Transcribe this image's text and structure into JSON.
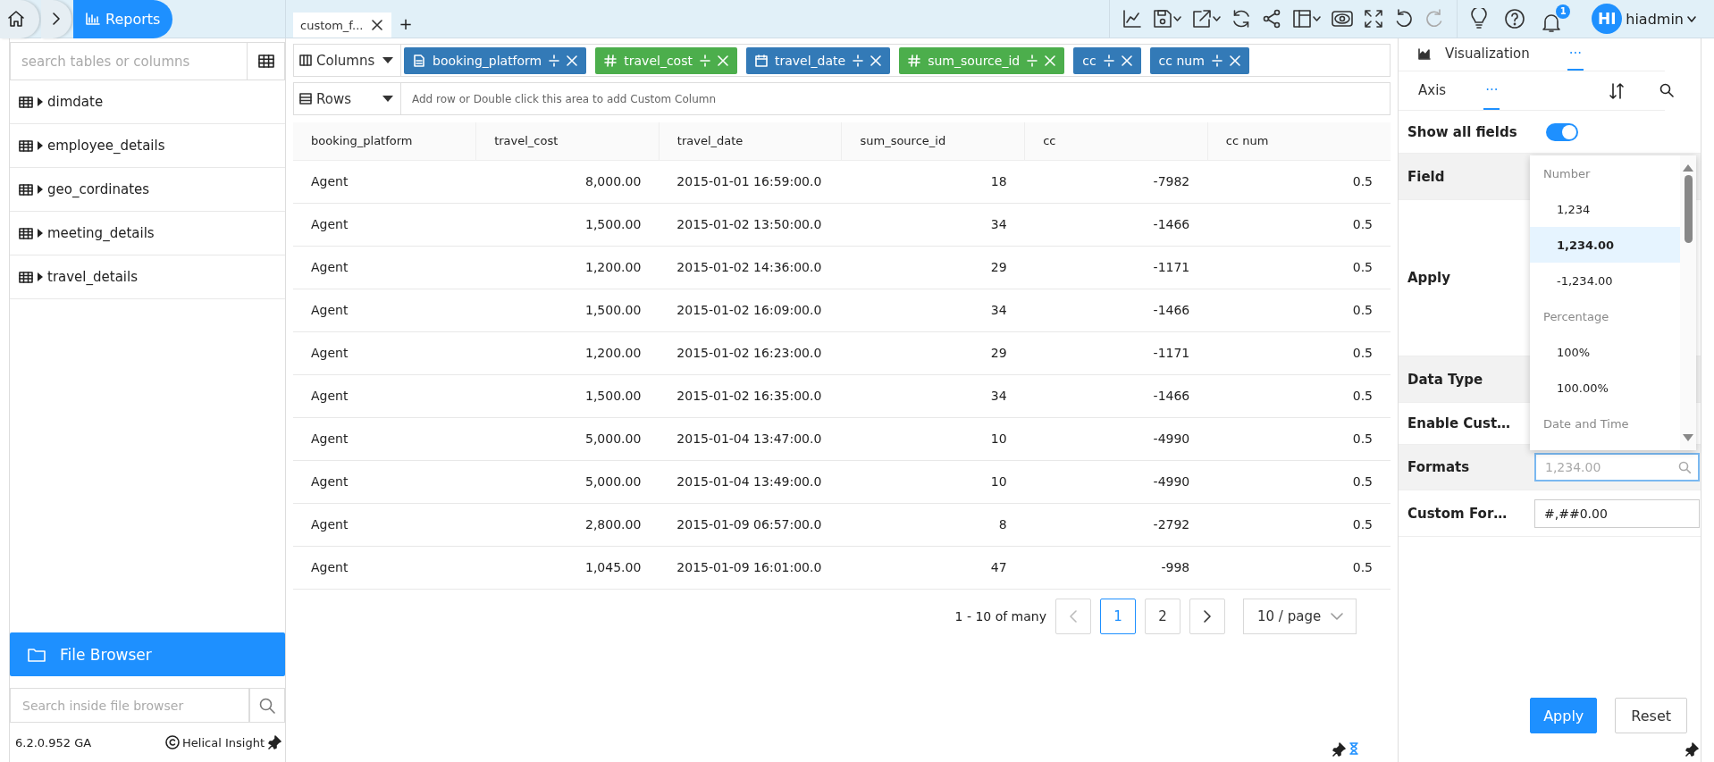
{
  "breadcrumb": {
    "current": "Reports"
  },
  "tabs": [
    {
      "label": "custom_f...",
      "selected": true
    }
  ],
  "new_tab": "+",
  "toolbar": [
    {
      "kind": "chart",
      "disabled": false
    },
    {
      "kind": "save",
      "disabled": false
    },
    {
      "kind": "export",
      "disabled": false
    },
    {
      "kind": "refresh",
      "disabled": false
    },
    {
      "kind": "share",
      "disabled": false
    },
    {
      "kind": "layout",
      "disabled": false
    },
    {
      "kind": "preview",
      "disabled": false
    },
    {
      "kind": "fullscreen",
      "disabled": false
    },
    {
      "kind": "undo",
      "disabled": false
    },
    {
      "kind": "redo",
      "disabled": true
    }
  ],
  "notification_count": "1",
  "user": {
    "initials": "HI",
    "name": "hiadmin"
  },
  "sidebar": {
    "search_placeholder": "search tables or columns",
    "tables": [
      {
        "name": "dimdate",
        "expanded": false
      },
      {
        "name": "employee_details",
        "expanded": false
      },
      {
        "name": "geo_cordinates",
        "expanded": false
      },
      {
        "name": "meeting_details",
        "expanded": false
      },
      {
        "name": "travel_details",
        "expanded": false
      }
    ],
    "file_browser": "File Browser",
    "file_search_placeholder": "Search inside file browser",
    "version": "6.2.0.952 GA",
    "brand": "Helical Insight"
  },
  "shelf": {
    "columns_label": "Columns",
    "rows_label": "Rows",
    "rows_placeholder": "Add row or Double click this area to add Custom Column",
    "columns": [
      {
        "name": "booking_platform",
        "kind": "text",
        "color": "#337ab7"
      },
      {
        "name": "travel_cost",
        "kind": "number",
        "color": "#4cae4c"
      },
      {
        "name": "travel_date",
        "kind": "date",
        "color": "#337ab7"
      },
      {
        "name": "sum_source_id",
        "kind": "number",
        "color": "#4cae4c"
      },
      {
        "name": "cc",
        "kind": "plain",
        "color": "#337ab7"
      },
      {
        "name": "cc num",
        "kind": "plain",
        "color": "#337ab7"
      }
    ]
  },
  "table": {
    "columns": [
      {
        "label": "booking_platform",
        "kind": "text"
      },
      {
        "label": "travel_cost",
        "kind": "number"
      },
      {
        "label": "travel_date",
        "kind": "text"
      },
      {
        "label": "sum_source_id",
        "kind": "number"
      },
      {
        "label": "cc",
        "kind": "number"
      },
      {
        "label": "cc num",
        "kind": "number"
      }
    ],
    "rows": [
      [
        "Agent",
        "8,000.00",
        "2015-01-01 16:59:00.0",
        "18",
        "-7982",
        "0.5"
      ],
      [
        "Agent",
        "1,500.00",
        "2015-01-02 13:50:00.0",
        "34",
        "-1466",
        "0.5"
      ],
      [
        "Agent",
        "1,200.00",
        "2015-01-02 14:36:00.0",
        "29",
        "-1171",
        "0.5"
      ],
      [
        "Agent",
        "1,500.00",
        "2015-01-02 16:09:00.0",
        "34",
        "-1466",
        "0.5"
      ],
      [
        "Agent",
        "1,200.00",
        "2015-01-02 16:23:00.0",
        "29",
        "-1171",
        "0.5"
      ],
      [
        "Agent",
        "1,500.00",
        "2015-01-02 16:35:00.0",
        "34",
        "-1466",
        "0.5"
      ],
      [
        "Agent",
        "5,000.00",
        "2015-01-04 13:47:00.0",
        "10",
        "-4990",
        "0.5"
      ],
      [
        "Agent",
        "5,000.00",
        "2015-01-04 13:49:00.0",
        "10",
        "-4990",
        "0.5"
      ],
      [
        "Agent",
        "2,800.00",
        "2015-01-09 06:57:00.0",
        "8",
        "-2792",
        "0.5"
      ],
      [
        "Agent",
        "1,045.00",
        "2015-01-09 16:01:00.0",
        "47",
        "-998",
        "0.5"
      ]
    ]
  },
  "pagination": {
    "summary": "1 - 10 of many",
    "pages": [
      {
        "label": "1",
        "selected": true
      },
      {
        "label": "2",
        "selected": false
      }
    ],
    "page_size": "10 / page"
  },
  "panel": {
    "tabs": [
      {
        "label": "Visualization",
        "selected": false
      },
      {
        "label": "···",
        "selected": true
      }
    ],
    "subtabs": [
      {
        "label": "Axis",
        "selected": false
      },
      {
        "label": "···",
        "selected": true
      }
    ],
    "show_all_fields": {
      "label": "Show all fields",
      "on": true
    },
    "properties": [
      {
        "label": "Field"
      },
      {
        "label": "Apply"
      },
      {
        "label": "Data Type"
      },
      {
        "label": "Enable Cust…"
      },
      {
        "label": "Formats",
        "kind": "search",
        "placeholder": "1,234.00"
      },
      {
        "label": "Custom For…",
        "kind": "input",
        "value": "#,##0.00"
      }
    ],
    "format_options": [
      {
        "kind": "group",
        "label": "Number"
      },
      {
        "kind": "option",
        "label": "1,234",
        "selected": false
      },
      {
        "kind": "option",
        "label": "1,234.00",
        "selected": true
      },
      {
        "kind": "option",
        "label": "-1,234.00",
        "selected": false
      },
      {
        "kind": "group",
        "label": "Percentage"
      },
      {
        "kind": "option",
        "label": "100%",
        "selected": false
      },
      {
        "kind": "option",
        "label": "100.00%",
        "selected": false
      },
      {
        "kind": "group",
        "label": "Date and Time"
      }
    ],
    "buttons": [
      {
        "label": "Apply",
        "kind": "primary"
      },
      {
        "label": "Reset",
        "kind": "default"
      }
    ]
  }
}
